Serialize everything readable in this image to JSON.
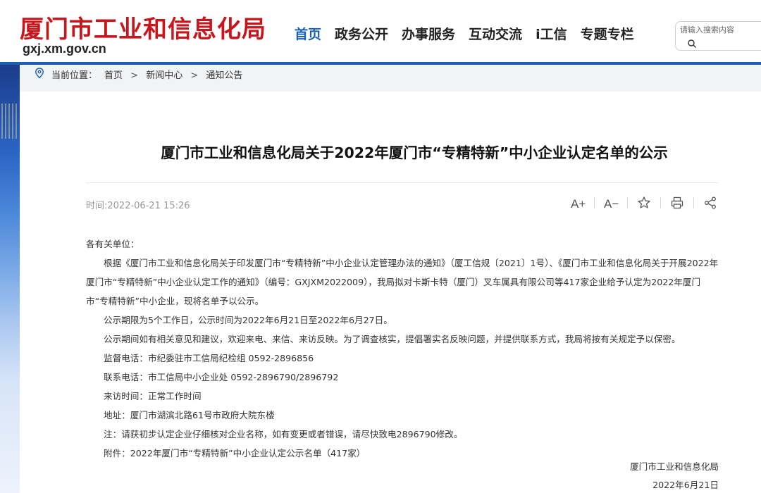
{
  "header": {
    "site_name": "厦门市工业和信息化局",
    "domain": "gxj.xm.gov.cn",
    "nav": [
      "首页",
      "政务公开",
      "办事服务",
      "互动交流",
      "i工信",
      "专题专栏"
    ],
    "search_placeholder": "请输入搜索内容"
  },
  "breadcrumb": {
    "prefix": "当前位置：",
    "items": [
      "首页",
      "新闻中心",
      "通知公告"
    ],
    "separator": ">"
  },
  "article": {
    "title": "厦门市工业和信息化局关于2022年厦门市“专精特新”中小企业认定名单的公示",
    "published": "时间:2022-06-21 15:26",
    "tools": [
      "A+",
      "A−"
    ],
    "salutation": "各有关单位：",
    "paragraph1": "根据《厦门市工业和信息化局关于印发厦门市“专精特新”中小企业认定管理办法的通知》（厦工信规〔2021〕1号）、《厦门市工业和信息化局关于开展2022年厦门市“专精特新”中小企业认定工作的通知》（编号：GXJXM2022009），我局拟对卡斯卡特（厦门）叉车属具有限公司等417家企业给予认定为2022年厦门市“专精特新”中小企业，现将名单予以公示。",
    "period": "公示期限为5个工作日，公示时间为2022年6月21日至2022年6月27日。",
    "feedback": "公示期间如有相关意见和建议，欢迎来电、来信、来访反映。为了调查核实，提倡署实名反映问题，并提供联系方式，我局将按有关规定予以保密。",
    "supervise_phone": "监督电话：市纪委驻市工信局纪检组 0592-2896856",
    "contact_phone": "联系电话：市工信局中小企业处 0592-2896790/2896792",
    "visit_time": "来访时间：正常工作时间",
    "address": "地址：厦门市湖滨北路61号市政府大院东楼",
    "note": "注：请获初步认定企业仔细核对企业名称，如有变更或者错误，请尽快致电2896790修改。",
    "attachment": "附件：2022年厦门市“专精特新”中小企业认定公示名单（417家）",
    "signature": "厦门市工业和信息化局",
    "sign_date": "2022年6月21日"
  },
  "colors": {
    "brand_red": "#c8161d",
    "nav_active": "#1a5fb4",
    "header_bar": "#1a5fb4"
  }
}
